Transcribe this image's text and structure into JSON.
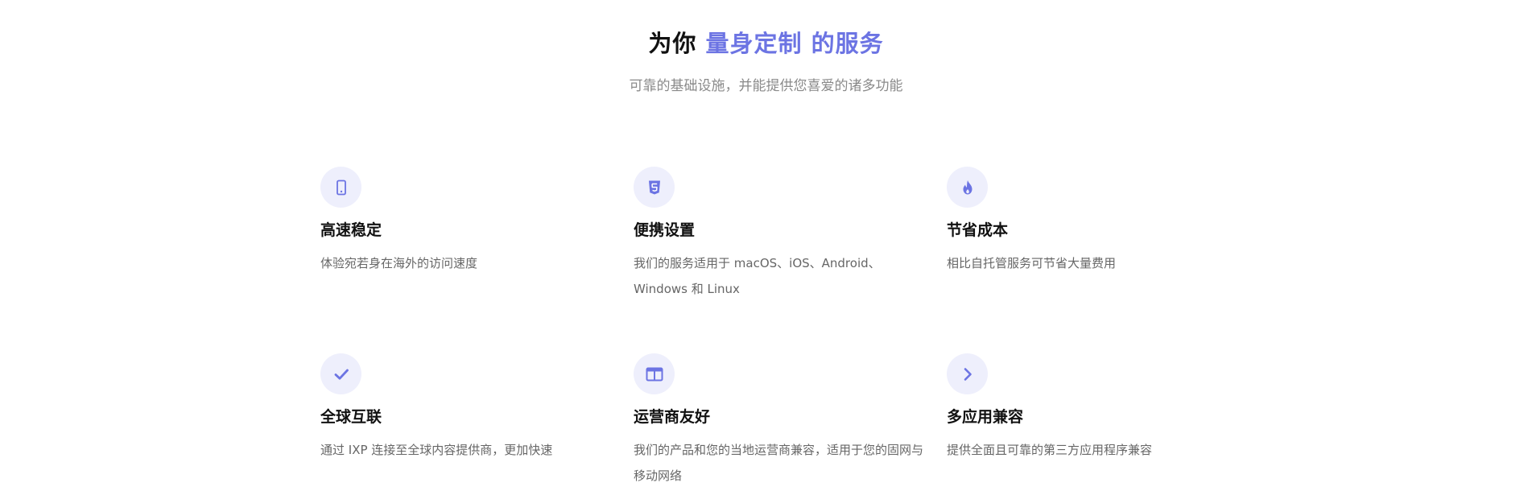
{
  "header": {
    "title_prefix": "为你 ",
    "title_accent": "量身定制 的服务",
    "subtitle": "可靠的基础设施，并能提供您喜爱的诸多功能"
  },
  "colors": {
    "accent": "#6c74e3",
    "icon_bg": "#eeeffc",
    "title": "#111111",
    "body_text": "#666666",
    "subtitle_text": "#8a8a8a"
  },
  "features": [
    {
      "icon": "mobile-phone-icon",
      "title": "高速稳定",
      "desc": "体验宛若身在海外的访问速度"
    },
    {
      "icon": "html5-icon",
      "title": "便携设置",
      "desc": "我们的服务适用于 macOS、iOS、Android、Windows 和 Linux"
    },
    {
      "icon": "flame-icon",
      "title": "节省成本",
      "desc": "相比自托管服务可节省大量费用"
    },
    {
      "icon": "checkmark-icon",
      "title": "全球互联",
      "desc": "通过 IXP 连接至全球内容提供商，更加快速"
    },
    {
      "icon": "columns-icon",
      "title": "运营商友好",
      "desc": "我们的产品和您的当地运营商兼容，适用于您的固网与移动网络"
    },
    {
      "icon": "chevron-right-icon",
      "title": "多应用兼容",
      "desc": "提供全面且可靠的第三方应用程序兼容"
    }
  ]
}
